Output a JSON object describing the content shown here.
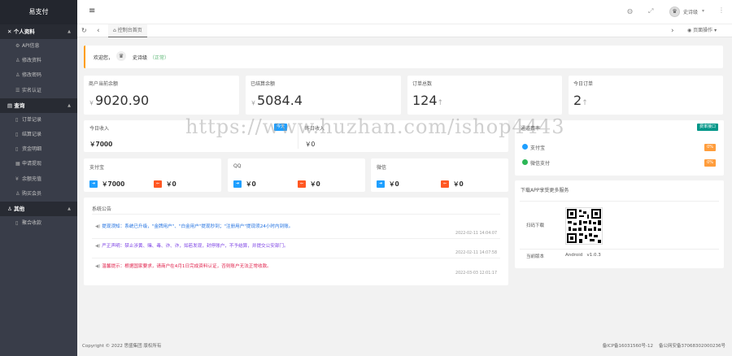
{
  "sidebar": {
    "logo": "易支付",
    "groups": [
      {
        "label": "个人资料",
        "icon": "wrench-icon",
        "items": [
          {
            "label": "API信息",
            "icon": "gear-icon"
          },
          {
            "label": "修改资料",
            "icon": "user-icon"
          },
          {
            "label": "修改密码",
            "icon": "user-icon"
          },
          {
            "label": "实名认证",
            "icon": "list-icon"
          }
        ]
      },
      {
        "label": "查询",
        "icon": "table-icon",
        "items": [
          {
            "label": "订单记录",
            "icon": "doc-icon"
          },
          {
            "label": "结算记录",
            "icon": "doc-icon"
          },
          {
            "label": "资金明细",
            "icon": "doc-icon"
          },
          {
            "label": "申请提现",
            "icon": "bank-icon"
          },
          {
            "label": "余额充值",
            "icon": "yen-icon"
          },
          {
            "label": "购买会员",
            "icon": "user-icon"
          }
        ]
      },
      {
        "label": "其他",
        "icon": "user-icon",
        "items": [
          {
            "label": "聚合收款",
            "icon": "doc-icon"
          }
        ]
      }
    ]
  },
  "topbar": {
    "menu_icon": "≡",
    "user_name": "史诗级",
    "user_caret": "▾"
  },
  "tabs": {
    "home_label": "控制台首页",
    "page_ops": "页面操作"
  },
  "welcome": {
    "text": "欢迎您，",
    "name": "史诗级",
    "status": "（正常）"
  },
  "stats": [
    {
      "label": "商户当前余额",
      "prefix": "￥",
      "value": "9020.90",
      "arrow": ""
    },
    {
      "label": "已结算余额",
      "prefix": "￥",
      "value": "5084.4",
      "arrow": ""
    },
    {
      "label": "订单总数",
      "prefix": "",
      "value": "124",
      "arrow": "↑"
    },
    {
      "label": "今日订单",
      "prefix": "",
      "value": "2",
      "arrow": "↑"
    }
  ],
  "today": {
    "income_label": "今日收入",
    "income_value": "￥7000",
    "badge": "今天",
    "second_label": "昨日收入",
    "second_value": "￥0"
  },
  "channels": [
    {
      "label": "支付宝",
      "v1": "￥7000",
      "v2": "￥0"
    },
    {
      "label": "QQ",
      "v1": "￥0",
      "v2": "￥0"
    },
    {
      "label": "微信",
      "v1": "￥0",
      "v2": "￥0"
    }
  ],
  "rates": {
    "title": "通道费率",
    "badge": "费率接口",
    "items": [
      {
        "label": "支付宝",
        "rate": "0%"
      },
      {
        "label": "微信支付",
        "rate": "0%"
      }
    ]
  },
  "download": {
    "title": "下载APP享受更多服务",
    "scan_label": "扫码下载",
    "version_label": "当前版本",
    "version_value": "Android   v1.0.3"
  },
  "notices": {
    "title": "系统公告",
    "items": [
      {
        "text": "提现须知：系统已升级，\"金牌用户\"、\"白金用户\"提现秒到；\"注册用户\"提现须24小时内到账。",
        "time": "2022-02-11 14:04:07",
        "color": "#1e6fe0"
      },
      {
        "text": "严正声明：禁止涉黄、赌、毒、诈、诈，如若发现，封停账户，不予结算，并提交公安部门。",
        "time": "2022-02-11 14:07:58",
        "color": "#7b3fe4"
      },
      {
        "text": "温馨提示：根据国家要求，请商户在4月1日完成资料认证，否则账户无法正常收款。",
        "time": "2022-03-03 12:01:17",
        "color": "#e0224c"
      }
    ]
  },
  "footer": {
    "left": "Copyright © 2022 思盛集团 版权所有",
    "right": "备ICP备16031560号-12    备公网安备37068302000236号"
  },
  "watermark": "https://www.huzhan.com/ishop4443",
  "colors": {
    "sidebar": "#393d49",
    "accent_blue": "#1e9fff",
    "accent_orange": "#ff5722",
    "green": "#5fb878"
  }
}
